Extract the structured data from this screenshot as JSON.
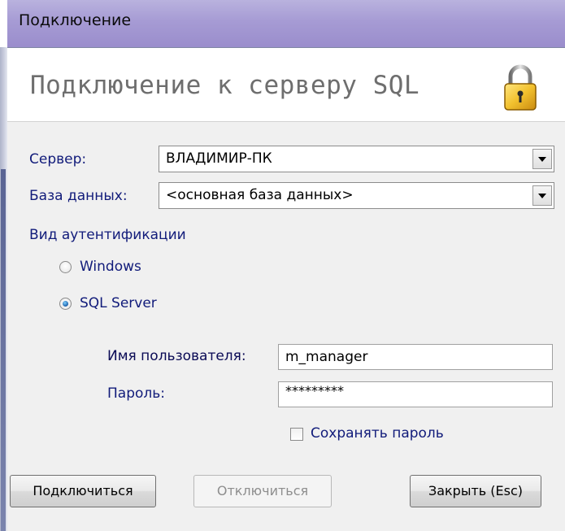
{
  "window": {
    "title": "Подключение"
  },
  "header": {
    "title": "Подключение к серверу SQL",
    "icon": "lock-icon"
  },
  "form": {
    "server_label": "Сервер:",
    "server_value": "ВЛАДИМИР-ПК",
    "database_label": "База данных:",
    "database_value": "<основная база данных>",
    "auth_label": "Вид аутентификации",
    "auth_options": [
      {
        "label": "Windows",
        "selected": false
      },
      {
        "label": "SQL Server",
        "selected": true
      }
    ],
    "username_label": "Имя пользователя:",
    "username_value": "m_manager",
    "password_label": "Пароль:",
    "password_value": "*********",
    "save_password_label": "Сохранять пароль",
    "save_password_checked": false
  },
  "buttons": {
    "connect": "Подключиться",
    "disconnect": "Отключиться",
    "close": "Закрыть (Esc)"
  },
  "colors": {
    "titlebar": "#a69bd4",
    "label_text": "#111b7a",
    "header_text": "#6e6e6e",
    "radio_selected": "#1a5ea8"
  }
}
